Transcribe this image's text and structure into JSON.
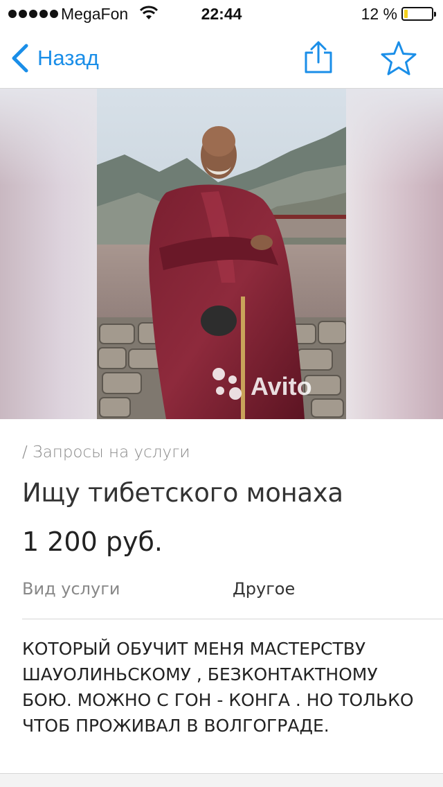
{
  "status_bar": {
    "carrier": "MegaFon",
    "time": "22:44",
    "battery_percent": "12 %",
    "battery_level": 0.12,
    "battery_color": "#f4d11f"
  },
  "nav": {
    "back_label": "Назад",
    "share_icon": "share-icon",
    "favorite_icon": "star-icon",
    "accent_color": "#1a8ee8"
  },
  "photo": {
    "watermark": "Avito"
  },
  "listing": {
    "breadcrumb": "/ Запросы на услуги",
    "title": "Ищу тибетского монаха",
    "price": "1 200 руб.",
    "params": [
      {
        "label": "Вид услуги",
        "value": "Другое"
      }
    ],
    "description": "КОТОРЫЙ ОБУЧИТ МЕНЯ МАСТЕРСТВУ ШАУОЛИНЬСКОМУ , БЕЗКОНТАКТНОМУ БОЮ. МОЖНО С ГОН - КОНГА . НО ТОЛЬКО ЧТОБ ПРОЖИВАЛ В ВОЛГОГРАДЕ."
  }
}
